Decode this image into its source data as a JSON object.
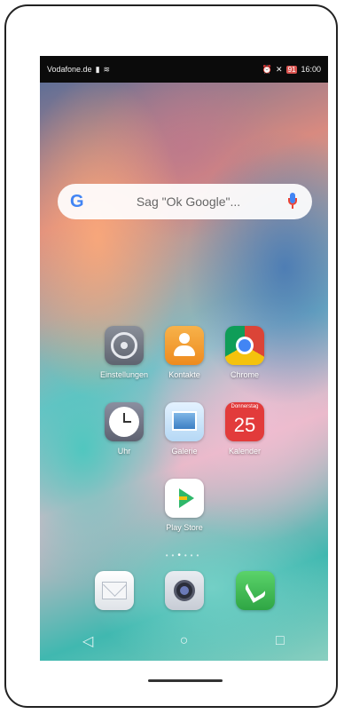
{
  "statusbar": {
    "carrier": "Vodafone.de",
    "signal_icon": "signal-icon",
    "wifi_icon": "wifi-icon",
    "battery": "91",
    "time": "16:00"
  },
  "search": {
    "logo": "G",
    "placeholder": "Sag \"Ok Google\"...",
    "mic_icon": "mic-icon"
  },
  "apps": [
    {
      "label": "Einstellungen",
      "icon": "settings-icon"
    },
    {
      "label": "Kontakte",
      "icon": "contacts-icon"
    },
    {
      "label": "Chrome",
      "icon": "chrome-icon"
    },
    {
      "label": "Uhr",
      "icon": "clock-icon"
    },
    {
      "label": "Galerie",
      "icon": "gallery-icon"
    },
    {
      "label": "Kalender",
      "icon": "calendar-icon",
      "weekday": "Donnerstag",
      "date": "25"
    },
    {
      "label": "Play Store",
      "icon": "play-store-icon"
    }
  ],
  "dock": [
    {
      "icon": "mail-icon"
    },
    {
      "icon": "camera-icon"
    },
    {
      "icon": "phone-icon"
    }
  ],
  "navbar": {
    "back": "◁",
    "home": "○",
    "recents": "□"
  },
  "colors": {
    "calendar": "#e23b3b",
    "phone": "#2fa544",
    "google_blue": "#4285f4"
  }
}
